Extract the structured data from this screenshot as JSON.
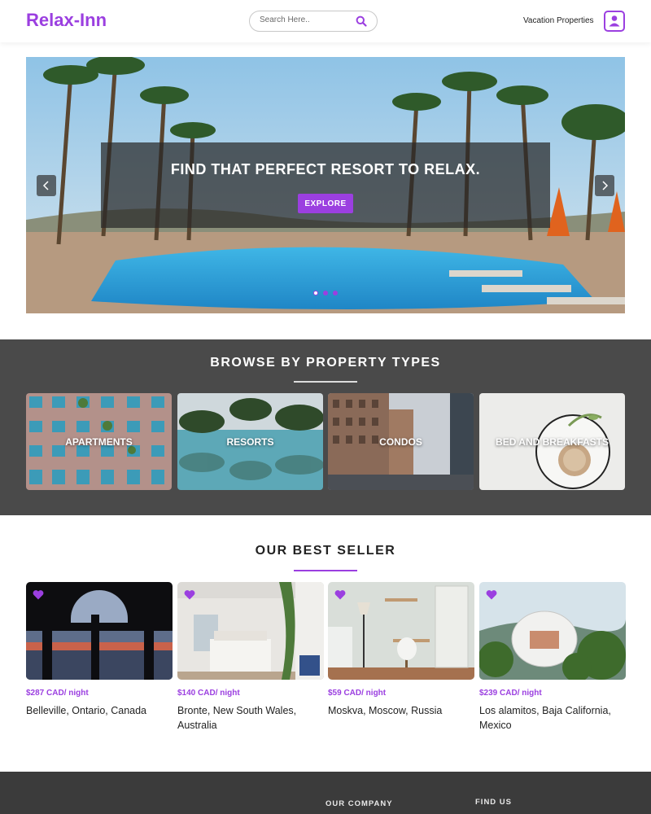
{
  "header": {
    "logo": "Relax-Inn",
    "search_placeholder": "Search Here..",
    "vacation_link": "Vacation Properties",
    "user_icon": "user-icon"
  },
  "hero": {
    "title": "FIND THAT PERFECT RESORT TO RELAX.",
    "button": "EXPLORE",
    "slides": 3,
    "active_slide": 1
  },
  "browse": {
    "title": "BROWSE BY PROPERTY TYPES",
    "types": [
      {
        "label": "APARTMENTS"
      },
      {
        "label": "RESORTS"
      },
      {
        "label": "CONDOS"
      },
      {
        "label": "BED AND BREAKFASTS"
      }
    ]
  },
  "best_seller": {
    "title": "OUR BEST SELLER",
    "items": [
      {
        "price": "$287 CAD/ night",
        "location": "Belleville, Ontario, Canada"
      },
      {
        "price": "$140 CAD/ night",
        "location": "Bronte, New South Wales, Australia"
      },
      {
        "price": "$59 CAD/ night",
        "location": "Moskva, Moscow, Russia"
      },
      {
        "price": "$239 CAD/ night",
        "location": "Los alamitos, Baja California, Mexico"
      }
    ]
  },
  "footer": {
    "company_heading": "OUR COMPANY",
    "find_heading": "FIND US"
  },
  "colors": {
    "accent": "#9b3fe0",
    "section_dark": "#4a4a4a",
    "footer": "#3b3b3b"
  }
}
